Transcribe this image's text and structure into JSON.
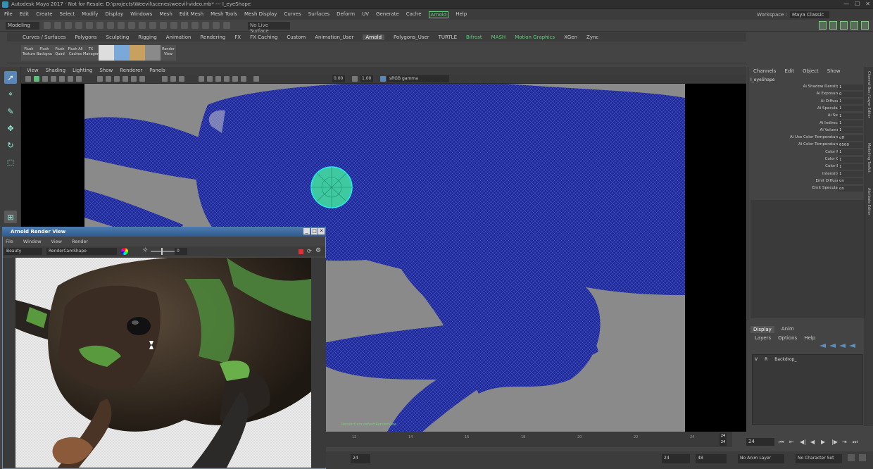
{
  "window": {
    "title": "Autodesk Maya 2017 - Not for Resale: D:\\projects\\Weevil\\scenes\\weevil-video.mb* --- I_eyeShape"
  },
  "menubar": {
    "items": [
      "File",
      "Edit",
      "Create",
      "Select",
      "Modify",
      "Display",
      "Windows",
      "Mesh",
      "Edit Mesh",
      "Mesh Tools",
      "Mesh Display",
      "Curves",
      "Surfaces",
      "Deform",
      "UV",
      "Generate",
      "Cache",
      "Arnold",
      "Help"
    ],
    "highlighted": "Arnold",
    "workspace_label": "Workspace :",
    "workspace_value": "Maya Classic"
  },
  "statusline": {
    "mode": "Modeling",
    "live_surface": "No Live Surface"
  },
  "shelf": {
    "tabs": [
      "Curves / Surfaces",
      "Polygons",
      "Sculpting",
      "Rigging",
      "Animation",
      "Rendering",
      "FX",
      "FX Caching",
      "Custom",
      "Animation_User",
      "Arnold",
      "Polygons_User",
      "TURTLE",
      "Bifrost",
      "MASH",
      "Motion Graphics",
      "XGen",
      "Zync"
    ],
    "active_tab": "Arnold",
    "buttons": [
      "Flush Texture",
      "Flush Background",
      "Flush Quad",
      "Flush All Caches",
      "TX Manager",
      "",
      "",
      "",
      "",
      "Render View"
    ]
  },
  "viewport": {
    "menu": [
      "View",
      "Shading",
      "Lighting",
      "Show",
      "Renderer",
      "Panels"
    ],
    "exposure": "0.00",
    "gamma": "1.00",
    "color_space": "sRGB gamma",
    "camera_label": "RenderCam:defaultRenderView"
  },
  "channel_box": {
    "menu": [
      "Channels",
      "Edit",
      "Object",
      "Show"
    ],
    "object": "I_eyeShape",
    "attributes": [
      {
        "name": "Ai Shadow Density",
        "value": "1"
      },
      {
        "name": "Ai Exposure",
        "value": "0"
      },
      {
        "name": "Ai Diffuse",
        "value": "1"
      },
      {
        "name": "Ai Specular",
        "value": "1"
      },
      {
        "name": "Ai Sss",
        "value": "1"
      },
      {
        "name": "Ai Indirect",
        "value": "1"
      },
      {
        "name": "Ai Volume",
        "value": "1"
      },
      {
        "name": "Ai Use Color Temperature",
        "value": "off"
      },
      {
        "name": "Ai Color Temperature",
        "value": "6500"
      },
      {
        "name": "Color R",
        "value": "1"
      },
      {
        "name": "Color G",
        "value": "1"
      },
      {
        "name": "Color B",
        "value": "1"
      },
      {
        "name": "Intensity",
        "value": "1"
      },
      {
        "name": "Emit Diffuse",
        "value": "on"
      },
      {
        "name": "Emit Specular",
        "value": "on"
      }
    ],
    "side_tabs": [
      "Channel Box / Layer Editor",
      "Modelling Toolkit",
      "Attribute Editor"
    ]
  },
  "layers": {
    "tabs": [
      "Display",
      "Anim"
    ],
    "active_tab": "Display",
    "menu": [
      "Layers",
      "Options",
      "Help"
    ],
    "rows": [
      {
        "v": "V",
        "r": "R",
        "name": "Backdrop_"
      }
    ]
  },
  "timeline": {
    "ticks": [
      "12",
      "14",
      "16",
      "18",
      "20",
      "22",
      "24"
    ],
    "current_frame": "24",
    "frame_field": "24",
    "range_start": "24",
    "range_end": "24",
    "range_end2": "48",
    "anim_layer": "No Anim Layer",
    "character_set": "No Character Set"
  },
  "render_view": {
    "title": "Arnold Render View",
    "menu": [
      "File",
      "Window",
      "View",
      "Render"
    ],
    "aov": "Beauty",
    "camera": "RenderCamShape",
    "exposure": "0"
  }
}
